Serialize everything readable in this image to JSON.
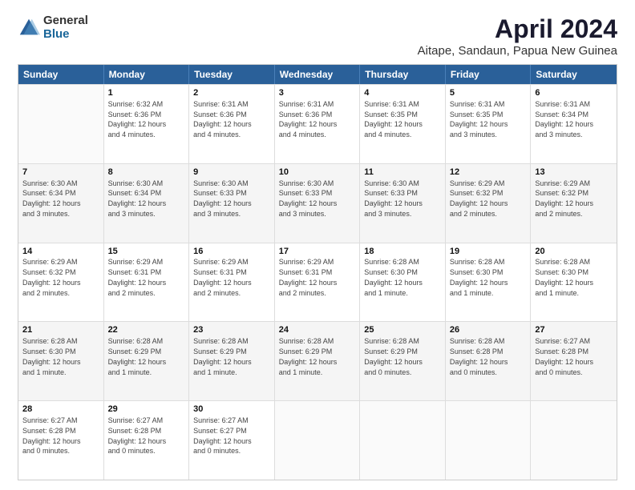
{
  "logo": {
    "general": "General",
    "blue": "Blue"
  },
  "header": {
    "title": "April 2024",
    "subtitle": "Aitape, Sandaun, Papua New Guinea"
  },
  "days": [
    "Sunday",
    "Monday",
    "Tuesday",
    "Wednesday",
    "Thursday",
    "Friday",
    "Saturday"
  ],
  "weeks": [
    [
      {
        "day": "",
        "text": ""
      },
      {
        "day": "1",
        "text": "Sunrise: 6:32 AM\nSunset: 6:36 PM\nDaylight: 12 hours\nand 4 minutes."
      },
      {
        "day": "2",
        "text": "Sunrise: 6:31 AM\nSunset: 6:36 PM\nDaylight: 12 hours\nand 4 minutes."
      },
      {
        "day": "3",
        "text": "Sunrise: 6:31 AM\nSunset: 6:36 PM\nDaylight: 12 hours\nand 4 minutes."
      },
      {
        "day": "4",
        "text": "Sunrise: 6:31 AM\nSunset: 6:35 PM\nDaylight: 12 hours\nand 4 minutes."
      },
      {
        "day": "5",
        "text": "Sunrise: 6:31 AM\nSunset: 6:35 PM\nDaylight: 12 hours\nand 3 minutes."
      },
      {
        "day": "6",
        "text": "Sunrise: 6:31 AM\nSunset: 6:34 PM\nDaylight: 12 hours\nand 3 minutes."
      }
    ],
    [
      {
        "day": "7",
        "text": "Sunrise: 6:30 AM\nSunset: 6:34 PM\nDaylight: 12 hours\nand 3 minutes."
      },
      {
        "day": "8",
        "text": "Sunrise: 6:30 AM\nSunset: 6:34 PM\nDaylight: 12 hours\nand 3 minutes."
      },
      {
        "day": "9",
        "text": "Sunrise: 6:30 AM\nSunset: 6:33 PM\nDaylight: 12 hours\nand 3 minutes."
      },
      {
        "day": "10",
        "text": "Sunrise: 6:30 AM\nSunset: 6:33 PM\nDaylight: 12 hours\nand 3 minutes."
      },
      {
        "day": "11",
        "text": "Sunrise: 6:30 AM\nSunset: 6:33 PM\nDaylight: 12 hours\nand 3 minutes."
      },
      {
        "day": "12",
        "text": "Sunrise: 6:29 AM\nSunset: 6:32 PM\nDaylight: 12 hours\nand 2 minutes."
      },
      {
        "day": "13",
        "text": "Sunrise: 6:29 AM\nSunset: 6:32 PM\nDaylight: 12 hours\nand 2 minutes."
      }
    ],
    [
      {
        "day": "14",
        "text": "Sunrise: 6:29 AM\nSunset: 6:32 PM\nDaylight: 12 hours\nand 2 minutes."
      },
      {
        "day": "15",
        "text": "Sunrise: 6:29 AM\nSunset: 6:31 PM\nDaylight: 12 hours\nand 2 minutes."
      },
      {
        "day": "16",
        "text": "Sunrise: 6:29 AM\nSunset: 6:31 PM\nDaylight: 12 hours\nand 2 minutes."
      },
      {
        "day": "17",
        "text": "Sunrise: 6:29 AM\nSunset: 6:31 PM\nDaylight: 12 hours\nand 2 minutes."
      },
      {
        "day": "18",
        "text": "Sunrise: 6:28 AM\nSunset: 6:30 PM\nDaylight: 12 hours\nand 1 minute."
      },
      {
        "day": "19",
        "text": "Sunrise: 6:28 AM\nSunset: 6:30 PM\nDaylight: 12 hours\nand 1 minute."
      },
      {
        "day": "20",
        "text": "Sunrise: 6:28 AM\nSunset: 6:30 PM\nDaylight: 12 hours\nand 1 minute."
      }
    ],
    [
      {
        "day": "21",
        "text": "Sunrise: 6:28 AM\nSunset: 6:30 PM\nDaylight: 12 hours\nand 1 minute."
      },
      {
        "day": "22",
        "text": "Sunrise: 6:28 AM\nSunset: 6:29 PM\nDaylight: 12 hours\nand 1 minute."
      },
      {
        "day": "23",
        "text": "Sunrise: 6:28 AM\nSunset: 6:29 PM\nDaylight: 12 hours\nand 1 minute."
      },
      {
        "day": "24",
        "text": "Sunrise: 6:28 AM\nSunset: 6:29 PM\nDaylight: 12 hours\nand 1 minute."
      },
      {
        "day": "25",
        "text": "Sunrise: 6:28 AM\nSunset: 6:29 PM\nDaylight: 12 hours\nand 0 minutes."
      },
      {
        "day": "26",
        "text": "Sunrise: 6:28 AM\nSunset: 6:28 PM\nDaylight: 12 hours\nand 0 minutes."
      },
      {
        "day": "27",
        "text": "Sunrise: 6:27 AM\nSunset: 6:28 PM\nDaylight: 12 hours\nand 0 minutes."
      }
    ],
    [
      {
        "day": "28",
        "text": "Sunrise: 6:27 AM\nSunset: 6:28 PM\nDaylight: 12 hours\nand 0 minutes."
      },
      {
        "day": "29",
        "text": "Sunrise: 6:27 AM\nSunset: 6:28 PM\nDaylight: 12 hours\nand 0 minutes."
      },
      {
        "day": "30",
        "text": "Sunrise: 6:27 AM\nSunset: 6:27 PM\nDaylight: 12 hours\nand 0 minutes."
      },
      {
        "day": "",
        "text": ""
      },
      {
        "day": "",
        "text": ""
      },
      {
        "day": "",
        "text": ""
      },
      {
        "day": "",
        "text": ""
      }
    ]
  ]
}
